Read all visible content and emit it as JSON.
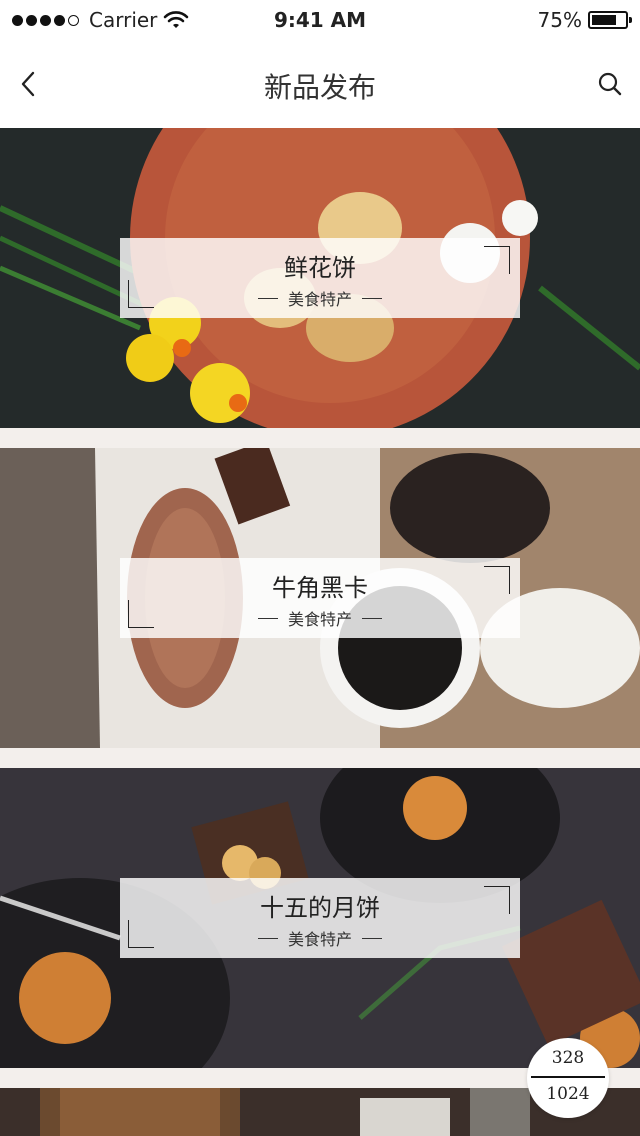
{
  "status_bar": {
    "carrier": "Carrier",
    "time": "9:41 AM",
    "battery": "75%",
    "battery_level": 0.75
  },
  "nav": {
    "title": "新品发布",
    "back_icon": "chevron-left-icon",
    "search_icon": "search-icon"
  },
  "cards": [
    {
      "title": "鲜花饼",
      "subtitle": "美食特产"
    },
    {
      "title": "牛角黑卡",
      "subtitle": "美食特产"
    },
    {
      "title": "十五的月饼",
      "subtitle": "美食特产"
    }
  ],
  "pagination": {
    "current": "328",
    "total": "1024"
  }
}
